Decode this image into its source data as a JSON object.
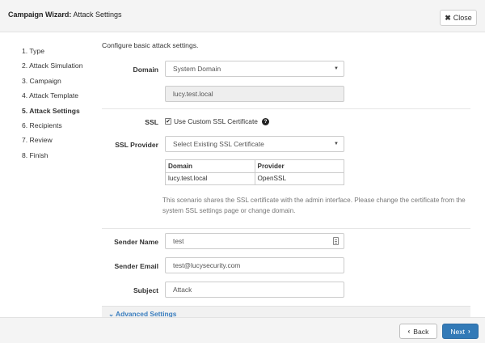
{
  "header": {
    "title_bold": "Campaign Wizard:",
    "title_rest": "Attack Settings",
    "close_label": "Close",
    "close_icon": "x-icon"
  },
  "steps": [
    {
      "label": "1. Type",
      "active": false
    },
    {
      "label": "2. Attack Simulation",
      "active": false
    },
    {
      "label": "3. Campaign",
      "active": false
    },
    {
      "label": "4. Attack Template",
      "active": false
    },
    {
      "label": "5. Attack Settings",
      "active": true
    },
    {
      "label": "6. Recipients",
      "active": false
    },
    {
      "label": "7. Review",
      "active": false
    },
    {
      "label": "8. Finish",
      "active": false
    }
  ],
  "form": {
    "intro": "Configure basic attack settings.",
    "domain_label": "Domain",
    "domain_value": "System Domain",
    "domain_host": "lucy.test.local",
    "ssl_label": "SSL",
    "ssl_checkbox_label": "Use Custom SSL Certificate",
    "ssl_checked": true,
    "ssl_provider_label": "SSL Provider",
    "ssl_provider_value": "Select Existing SSL Certificate",
    "ssl_table": {
      "headers": [
        "Domain",
        "Provider"
      ],
      "rows": [
        [
          "lucy.test.local",
          "OpenSSL"
        ]
      ]
    },
    "help_text": "This scenario shares the SSL certificate with the admin interface. Please change the certificate from the system SSL settings page or change domain.",
    "sender_name_label": "Sender Name",
    "sender_name_value": "test",
    "sender_email_label": "Sender Email",
    "sender_email_value": "test@lucysecurity.com",
    "subject_label": "Subject",
    "subject_value": "Attack",
    "advanced_label": "Advanced Settings"
  },
  "footer": {
    "back_label": "Back",
    "next_label": "Next"
  },
  "colors": {
    "primary": "#337ab7",
    "link": "#3a7ebf"
  }
}
